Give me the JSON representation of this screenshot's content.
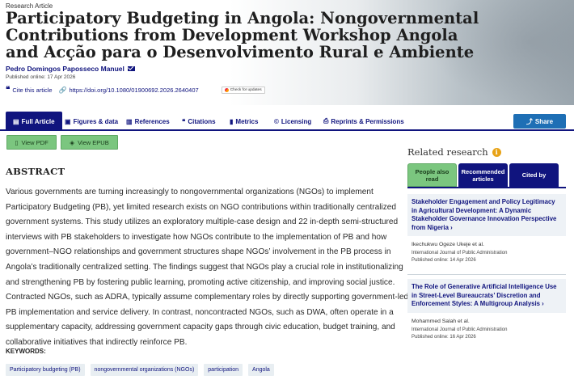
{
  "article": {
    "type": "Research Article",
    "title": "Participatory Budgeting in Angola: Nongovernmental Contributions from Development Workshop Angola and Acção para o Desenvolvimento Rural e Ambiente",
    "author": "Pedro Domingos Paposseco Manuel",
    "published": "Published online: 17 Apr 2026",
    "cite_label": "Cite this article",
    "doi": "https://doi.org/10.1080/01900692.2026.2640407",
    "updates_badge": "Check for updates"
  },
  "tabs": [
    {
      "label": "Full Article",
      "icon": "document-icon"
    },
    {
      "label": "Figures & data",
      "icon": "image-icon"
    },
    {
      "label": "References",
      "icon": "book-icon"
    },
    {
      "label": "Citations",
      "icon": "quote-icon"
    },
    {
      "label": "Metrics",
      "icon": "bar-chart-icon"
    },
    {
      "label": "Licensing",
      "icon": "copyright-icon"
    },
    {
      "label": "Reprints & Permissions",
      "icon": "printer-icon"
    }
  ],
  "share_label": "Share",
  "buttons": {
    "pdf": "View PDF",
    "epub": "View EPUB"
  },
  "abstract": {
    "heading": "ABSTRACT",
    "text": "Various governments are turning increasingly to nongovernmental organizations (NGOs) to implement Participatory Budgeting (PB), yet limited research exists on NGO contributions within traditionally centralized government systems. This study utilizes an exploratory multiple-case design and 22 in-depth semi-structured interviews with PB stakeholders to investigate how NGOs contribute to the implementation of PB and how government–NGO relationships and government structures shape NGOs’ involvement in the PB process in Angola’s traditionally centralized setting. The findings suggest that NGOs play a crucial role in institutionalizing and strengthening PB by fostering public learning, promoting active citizenship, and improving social justice. Contracted NGOs, such as ADRA, typically assume complementary roles by directly supporting government-led PB implementation and service delivery. In contrast, noncontracted NGOs, such as DWA, often operate in a supplementary capacity, addressing government capacity gaps through civic education, budget training, and collaborative initiatives that indirectly reinforce PB."
  },
  "keywords": {
    "heading": "KEYWORDS:",
    "items": [
      "Participatory budgeting (PB)",
      "nongovernmental organizations (NGOs)",
      "participation",
      "Angola"
    ]
  },
  "related": {
    "heading": "Related research",
    "tabs": [
      "People also read",
      "Recommended articles",
      "Cited by"
    ],
    "cards": [
      {
        "title": "Stakeholder Engagement and Policy Legitimacy in Agricultural Development: A Dynamic Stakeholder Governance Innovation Perspective from Nigeria",
        "authors": "Ikechukwu Ogeze Ukeje et al.",
        "journal": "International Journal of Public Administration",
        "date": "Published online: 14 Apr 2026"
      },
      {
        "title": "The Role of Generative Artificial Intelligence Use in Street-Level Bureaucrats’ Discretion and Enforcement Styles: A Multigroup Analysis",
        "authors": "Mohammed Salah et al.",
        "journal": "International Journal of Public Administration",
        "date": "Published online: 16 Apr 2026"
      }
    ]
  },
  "colors": {
    "navy": "#10147e",
    "green": "#7bc67f",
    "share_blue": "#1e6fb5",
    "info_orange": "#e8a317"
  }
}
